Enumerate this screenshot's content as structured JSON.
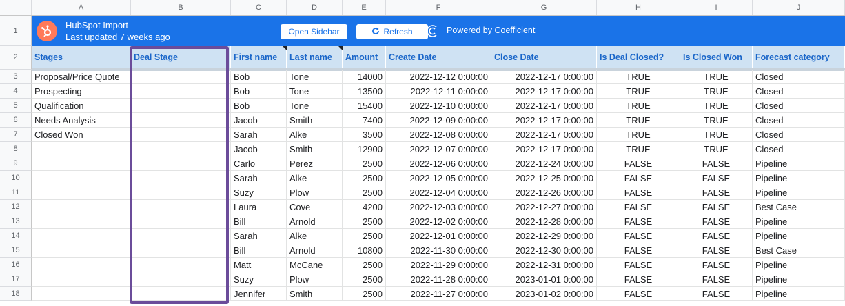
{
  "columns": [
    "A",
    "B",
    "C",
    "D",
    "E",
    "F",
    "G",
    "H",
    "I",
    "J"
  ],
  "banner": {
    "title": "HubSpot Import",
    "subtitle": "Last updated 7 weeks ago",
    "open_sidebar": "Open Sidebar",
    "refresh": "Refresh",
    "powered": "Powered by Coefficient",
    "accent": "#1a73e8"
  },
  "headers": [
    "Stages",
    "Deal Stage",
    "First name",
    "Last name",
    "Amount",
    "Create Date",
    "Close Date",
    "Is Deal Closed?",
    "Is Closed Won",
    "Forecast category"
  ],
  "stages": [
    "Proposal/Price Quote",
    "Prospecting",
    "Qualification",
    "Needs Analysis",
    "Closed Won"
  ],
  "rows": [
    {
      "n": "3",
      "first": "Bob",
      "last": "Tone",
      "amount": "14000",
      "create": "2022-12-12 0:00:00",
      "close": "2022-12-17 0:00:00",
      "closed": "TRUE",
      "won": "TRUE",
      "forecast": "Closed"
    },
    {
      "n": "4",
      "first": "Bob",
      "last": "Tone",
      "amount": "13500",
      "create": "2022-12-11 0:00:00",
      "close": "2022-12-17 0:00:00",
      "closed": "TRUE",
      "won": "TRUE",
      "forecast": "Closed"
    },
    {
      "n": "5",
      "first": "Bob",
      "last": "Tone",
      "amount": "15400",
      "create": "2022-12-10 0:00:00",
      "close": "2022-12-17 0:00:00",
      "closed": "TRUE",
      "won": "TRUE",
      "forecast": "Closed"
    },
    {
      "n": "6",
      "first": "Jacob",
      "last": "Smith",
      "amount": "7400",
      "create": "2022-12-09 0:00:00",
      "close": "2022-12-17 0:00:00",
      "closed": "TRUE",
      "won": "TRUE",
      "forecast": "Closed"
    },
    {
      "n": "7",
      "first": "Sarah",
      "last": "Alke",
      "amount": "3500",
      "create": "2022-12-08 0:00:00",
      "close": "2022-12-17 0:00:00",
      "closed": "TRUE",
      "won": "TRUE",
      "forecast": "Closed"
    },
    {
      "n": "8",
      "first": "Jacob",
      "last": "Smith",
      "amount": "12900",
      "create": "2022-12-07 0:00:00",
      "close": "2022-12-17 0:00:00",
      "closed": "TRUE",
      "won": "TRUE",
      "forecast": "Closed"
    },
    {
      "n": "9",
      "first": "Carlo",
      "last": "Perez",
      "amount": "2500",
      "create": "2022-12-06 0:00:00",
      "close": "2022-12-24 0:00:00",
      "closed": "FALSE",
      "won": "FALSE",
      "forecast": "Pipeline"
    },
    {
      "n": "10",
      "first": "Sarah",
      "last": "Alke",
      "amount": "2500",
      "create": "2022-12-05 0:00:00",
      "close": "2022-12-25 0:00:00",
      "closed": "FALSE",
      "won": "FALSE",
      "forecast": "Pipeline"
    },
    {
      "n": "11",
      "first": "Suzy",
      "last": "Plow",
      "amount": "2500",
      "create": "2022-12-04 0:00:00",
      "close": "2022-12-26 0:00:00",
      "closed": "FALSE",
      "won": "FALSE",
      "forecast": "Pipeline"
    },
    {
      "n": "12",
      "first": "Laura",
      "last": "Cove",
      "amount": "4200",
      "create": "2022-12-03 0:00:00",
      "close": "2022-12-27 0:00:00",
      "closed": "FALSE",
      "won": "FALSE",
      "forecast": "Best Case"
    },
    {
      "n": "13",
      "first": "Bill",
      "last": "Arnold",
      "amount": "2500",
      "create": "2022-12-02 0:00:00",
      "close": "2022-12-28 0:00:00",
      "closed": "FALSE",
      "won": "FALSE",
      "forecast": "Pipeline"
    },
    {
      "n": "14",
      "first": "Sarah",
      "last": "Alke",
      "amount": "2500",
      "create": "2022-12-01 0:00:00",
      "close": "2022-12-29 0:00:00",
      "closed": "FALSE",
      "won": "FALSE",
      "forecast": "Pipeline"
    },
    {
      "n": "15",
      "first": "Bill",
      "last": "Arnold",
      "amount": "10800",
      "create": "2022-11-30 0:00:00",
      "close": "2022-12-30 0:00:00",
      "closed": "FALSE",
      "won": "FALSE",
      "forecast": "Best Case"
    },
    {
      "n": "16",
      "first": "Matt",
      "last": "McCane",
      "amount": "2500",
      "create": "2022-11-29 0:00:00",
      "close": "2022-12-31 0:00:00",
      "closed": "FALSE",
      "won": "FALSE",
      "forecast": "Pipeline"
    },
    {
      "n": "17",
      "first": "Suzy",
      "last": "Plow",
      "amount": "2500",
      "create": "2022-11-28 0:00:00",
      "close": "2023-01-01 0:00:00",
      "closed": "FALSE",
      "won": "FALSE",
      "forecast": "Pipeline"
    },
    {
      "n": "18",
      "first": "Jennifer",
      "last": "Smith",
      "amount": "2500",
      "create": "2022-11-27 0:00:00",
      "close": "2023-01-02 0:00:00",
      "closed": "FALSE",
      "won": "FALSE",
      "forecast": "Pipeline"
    }
  ]
}
